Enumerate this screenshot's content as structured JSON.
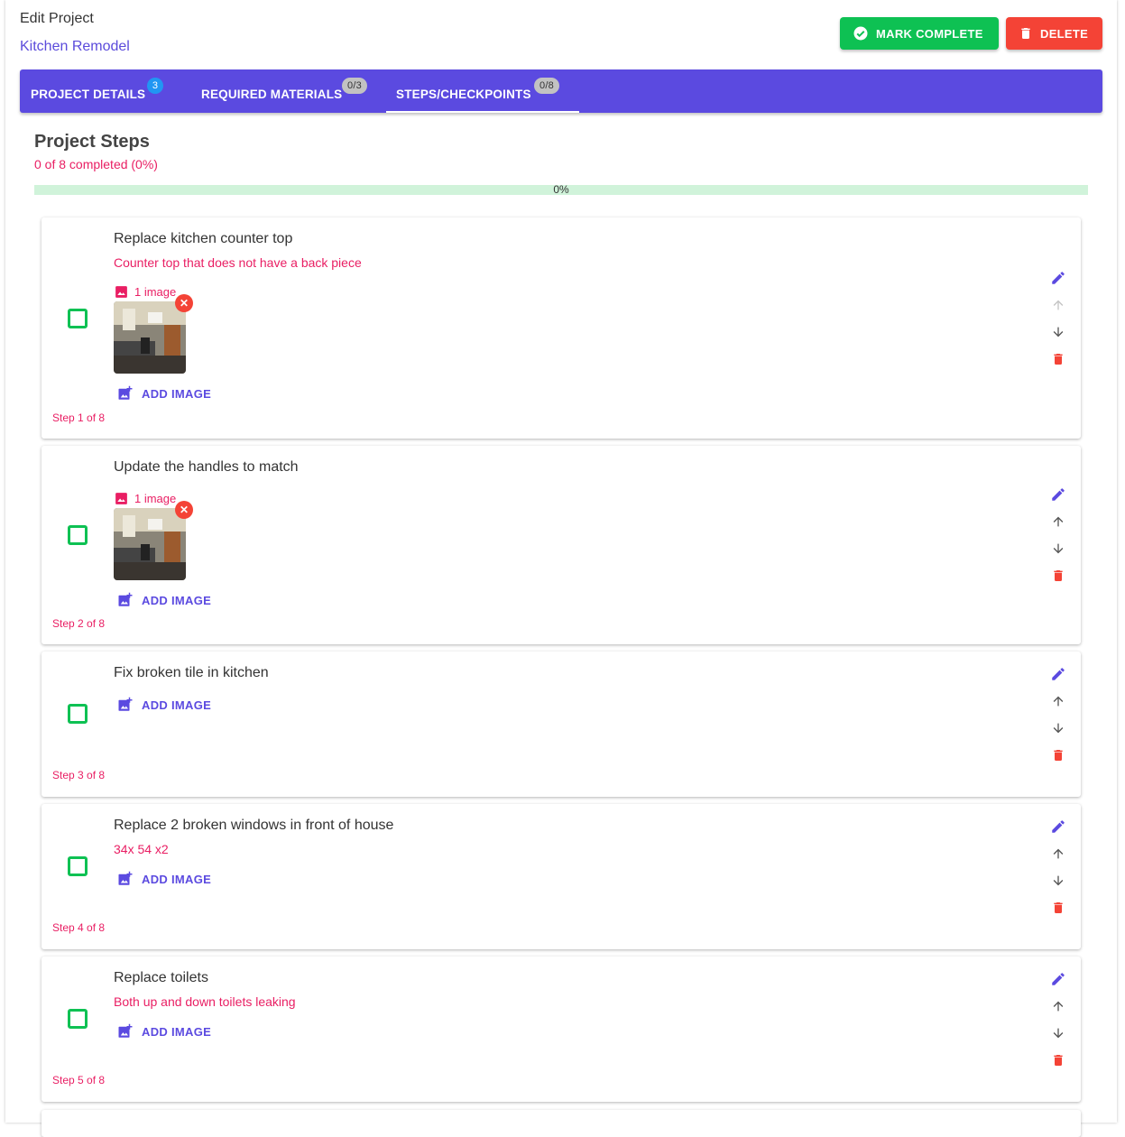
{
  "header": {
    "title": "Edit Project",
    "project_name": "Kitchen Remodel",
    "mark_complete_label": "MARK COMPLETE",
    "delete_label": "DELETE"
  },
  "tabs": [
    {
      "label": "PROJECT DETAILS",
      "badge": "3",
      "active": false
    },
    {
      "label": "REQUIRED MATERIALS",
      "badge": "0/3",
      "active": false
    },
    {
      "label": "STEPS/CHECKPOINTS",
      "badge": "0/8",
      "active": true
    }
  ],
  "steps_section": {
    "title": "Project Steps",
    "summary": "0 of 8 completed (0%)",
    "progress_label": "0%",
    "progress_fraction": 0
  },
  "steps": [
    {
      "title": "Replace kitchen counter top",
      "description": "Counter top that does not have a back piece",
      "image_count_label": "1 image",
      "add_image_label": "ADD IMAGE",
      "step_label": "Step 1 of 8"
    },
    {
      "title": "Update the handles to match",
      "image_count_label": "1 image",
      "add_image_label": "ADD IMAGE",
      "step_label": "Step 2 of 8"
    },
    {
      "title": "Fix broken tile in kitchen",
      "add_image_label": "ADD IMAGE",
      "step_label": "Step 3 of 8"
    },
    {
      "title": "Replace 2 broken windows in front of house",
      "description": "34x 54 x2",
      "add_image_label": "ADD IMAGE",
      "step_label": "Step 4 of 8"
    },
    {
      "title": "Replace toilets",
      "description": "Both up and down toilets leaking",
      "add_image_label": "ADD IMAGE",
      "step_label": "Step 5 of 8"
    }
  ],
  "colors": {
    "primary": "#5b4ae0",
    "success": "#0ec153",
    "danger": "#f44336",
    "accent": "#e91e63",
    "progress_track": "#d0f3da"
  },
  "icons": [
    "check-circle-icon",
    "trash-icon",
    "image-icon",
    "add-photo-icon",
    "close-icon",
    "edit-icon",
    "arrow-up-icon",
    "arrow-down-icon"
  ]
}
